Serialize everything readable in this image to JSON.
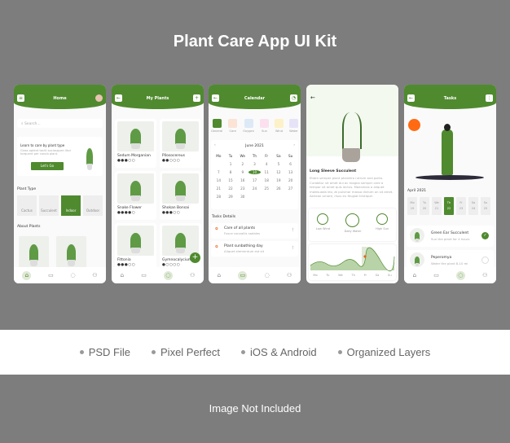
{
  "title": "Plant Care App UI Kit",
  "features": [
    "PSD File",
    "Pixel Perfect",
    "iOS & Android",
    "Organized Layers"
  ],
  "note": "Image Not Included",
  "colors": {
    "brand": "#4f8a2f",
    "accent": "#e8641c"
  },
  "home": {
    "title": "Home",
    "search_placeholder": "Search...",
    "banner_title": "Learn to care by plant type",
    "banner_text": "Class aptent taciti sociosquen litor torquent per conub plant.",
    "banner_button": "Let's Go",
    "plant_type_heading": "Plant Type",
    "types": [
      "Cactus",
      "Succulent",
      "Indoor",
      "Outdoor"
    ],
    "selected_type": "Indoor",
    "about_heading": "About Plants"
  },
  "my_plants": {
    "title": "My Plants",
    "plants": [
      {
        "name": "Sedum Morganian",
        "rating": 3
      },
      {
        "name": "Pilosocereus",
        "rating": 2
      },
      {
        "name": "Snake Flower",
        "rating": 4
      },
      {
        "name": "Shokan Bonsai",
        "rating": 3
      },
      {
        "name": "Fittonia",
        "rating": 3
      },
      {
        "name": "Gymnocalycium",
        "rating": 1
      }
    ]
  },
  "calendar": {
    "title": "Calendar",
    "categories": [
      "General",
      "Care",
      "Oxygen",
      "Sun",
      "Wind",
      "Water"
    ],
    "month": "June 2021",
    "weekdays": [
      "Mo",
      "Tu",
      "We",
      "Th",
      "Fr",
      "Sa",
      "Su"
    ],
    "days": [
      "",
      "1",
      "2",
      "3",
      "4",
      "5",
      "6",
      "7",
      "8",
      "9",
      "10",
      "11",
      "12",
      "13",
      "14",
      "15",
      "16",
      "17",
      "18",
      "19",
      "20",
      "21",
      "22",
      "23",
      "24",
      "25",
      "26",
      "27",
      "28",
      "29",
      "30"
    ],
    "selected_day": "10",
    "tasks_heading": "Tasks Details",
    "tasks": [
      {
        "title": "Care of all plants",
        "desc": "Fusce convallis sodales"
      },
      {
        "title": "Plant sunbathing day",
        "desc": "Aliquet elementum est sit"
      }
    ]
  },
  "detail": {
    "name": "Long Sleeve Succulent",
    "desc": "Etiam semper plant pharetra rutrum and porta. Curabitur sit amet dui ac magna semper care a tempor sit amet quis lectus. Maecenas a aliquet malesuada leo, at pulvinar massa dictum on sit amet. Aenean ornare, risus eu feugiat tristique.",
    "stats": [
      "Low Wind",
      "Daily Water",
      "High Sun"
    ],
    "chart_days": [
      "Mo",
      "Tu",
      "We",
      "Th",
      "Fr",
      "Sa",
      "Su"
    ]
  },
  "tasks": {
    "title": "Tasks",
    "month": "April 2021",
    "week": [
      {
        "d": "Mo",
        "n": "19"
      },
      {
        "d": "Tu",
        "n": "20"
      },
      {
        "d": "We",
        "n": "21"
      },
      {
        "d": "Th",
        "n": "22"
      },
      {
        "d": "Fr",
        "n": "23"
      },
      {
        "d": "Sa",
        "n": "24"
      },
      {
        "d": "Su",
        "n": "25"
      }
    ],
    "selected": "22",
    "items": [
      {
        "title": "Green Ear Succulent",
        "desc": "Sun the plant for 4 hours",
        "done": true
      },
      {
        "title": "Peperomya",
        "desc": "Water the plant 8-10 ml",
        "done": false
      }
    ]
  }
}
